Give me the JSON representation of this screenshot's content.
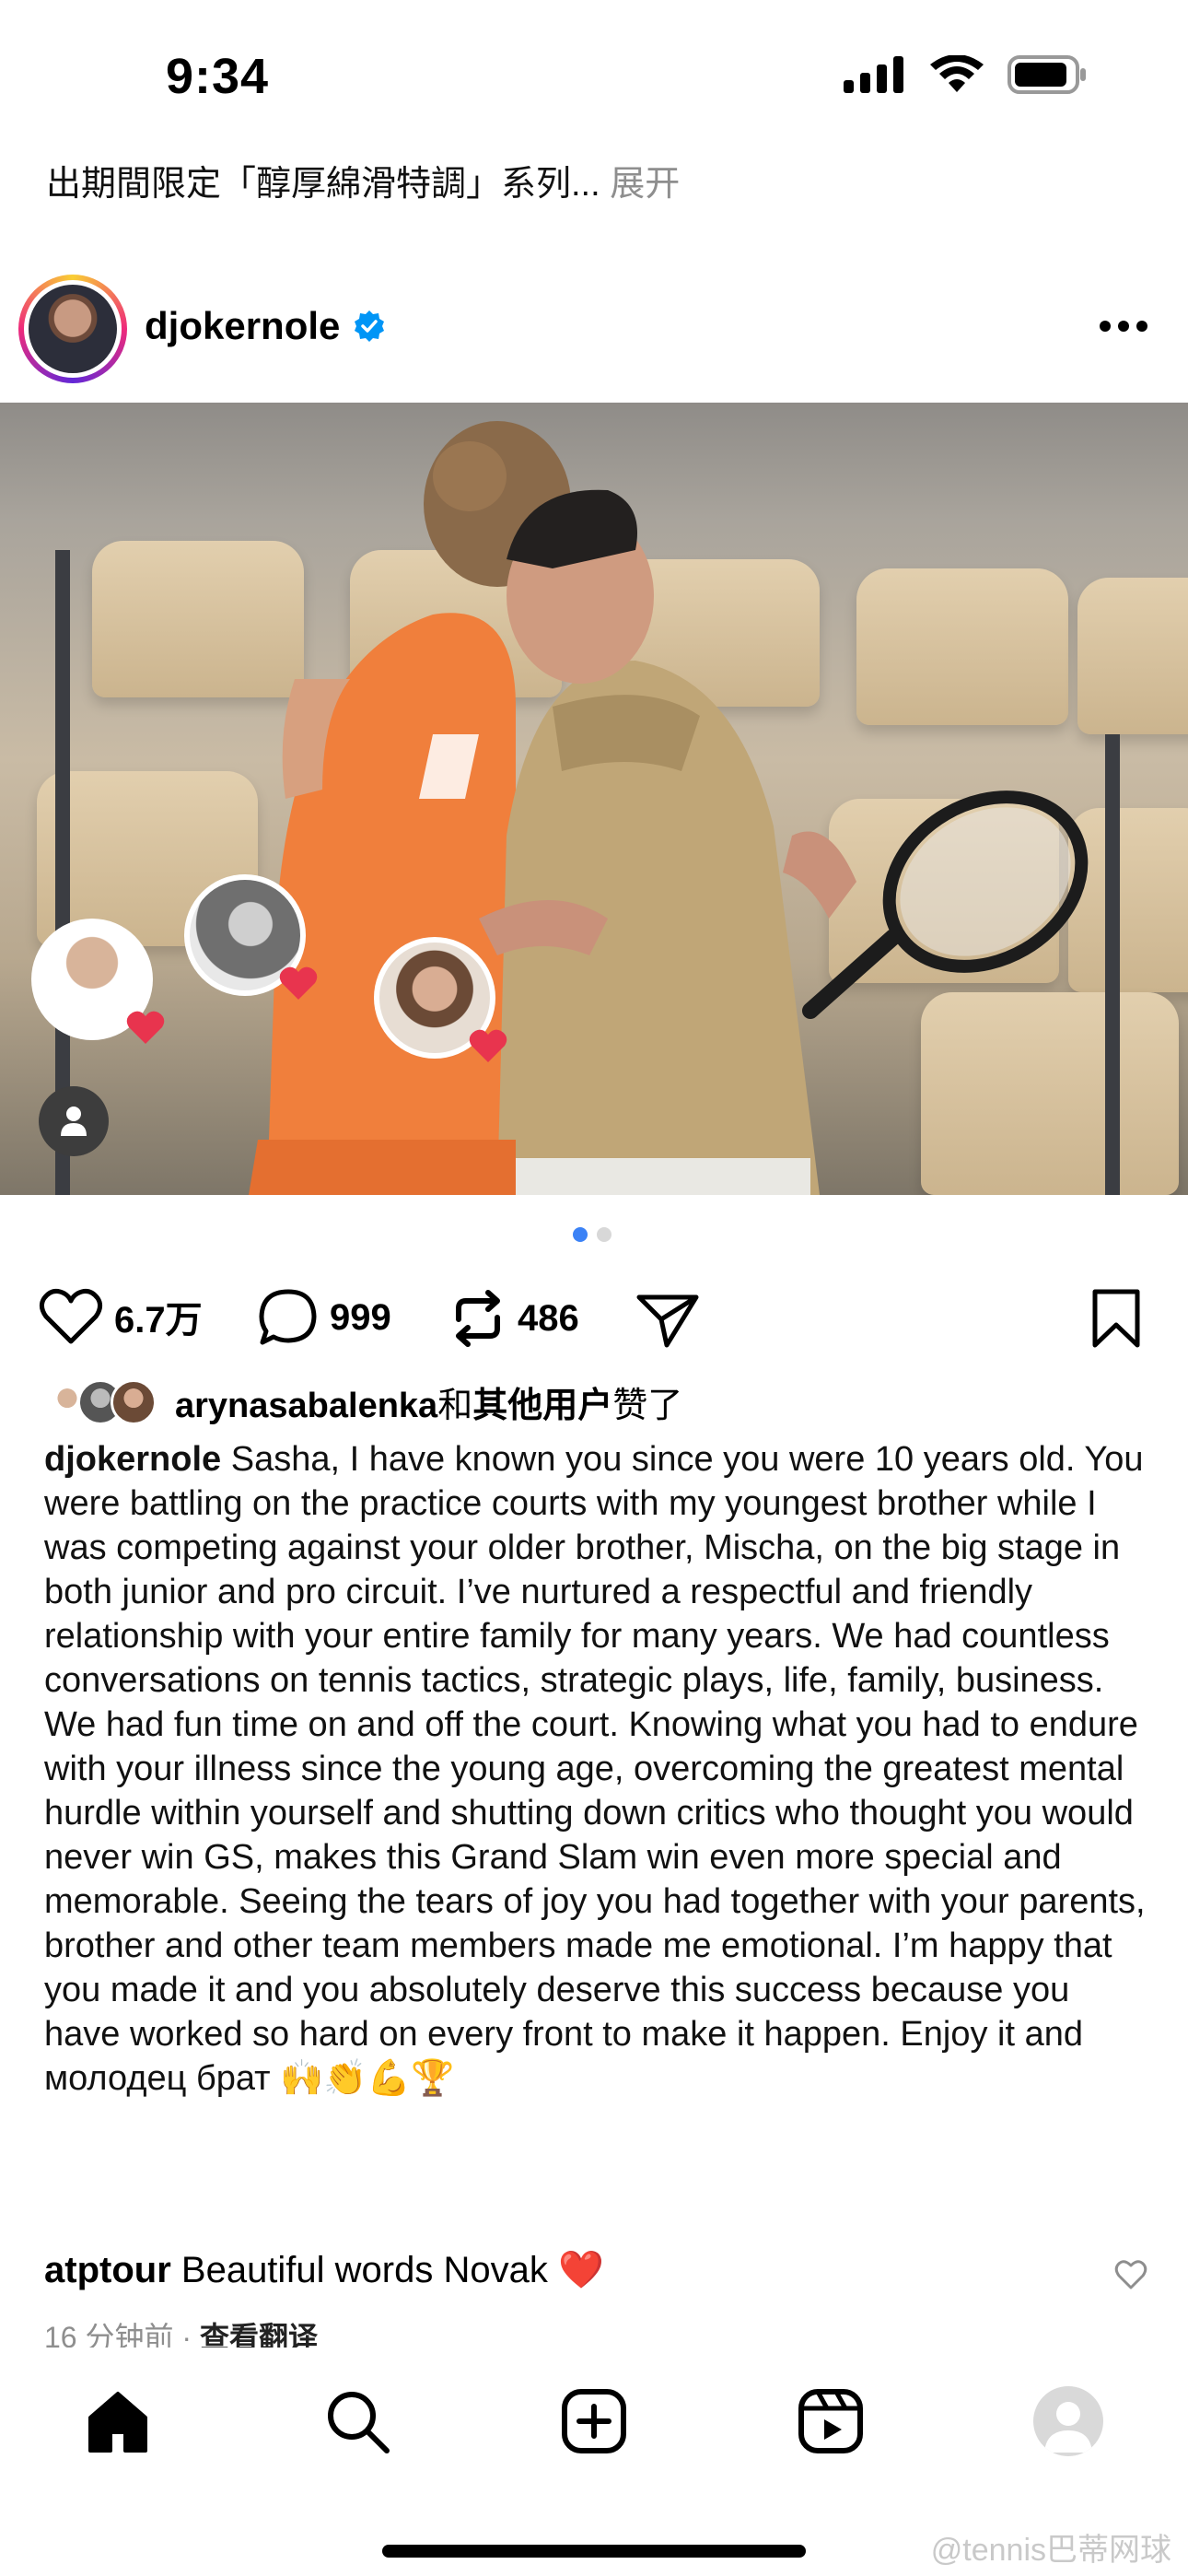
{
  "status_bar": {
    "time": "9:34"
  },
  "previous_post": {
    "caption_tail": "出期間限定「醇厚綿滑特調」系列...",
    "more_label": "展开"
  },
  "post": {
    "username": "djokernole",
    "likes_count": "6.7万",
    "comments_count": "999",
    "reposts_count": "486",
    "liked_by": {
      "user": "arynasabalenka",
      "suffix": "和",
      "others": "其他用户",
      "tail": "赞了"
    },
    "caption_user": "djokernole",
    "caption_text": "Sasha, I have known you since you were 10 years old. You were battling on the practice courts with my youngest brother while I was competing against your older brother, Mischa, on the big stage in both junior and pro circuit. I’ve nurtured a respectful and friendly relationship with your entire family for many years. We had countless conversations on tennis tactics, strategic plays, life, family, business. We had fun time on and off the court. Knowing what you had to endure with your illness since the young age, overcoming the greatest mental hurdle within yourself and shutting down critics who thought you would never win GS, makes this Grand Slam win even more special and memorable. Seeing the tears of joy you had together with your parents, brother and other team members made me emotional. I’m happy that you made it and you absolutely deserve this success because you have worked so hard on every front to make it happen. Enjoy it and молодец брат 🙌👏💪🏆",
    "comment": {
      "user": "atptour",
      "text": "Beautiful words Novak ❤️"
    },
    "timestamp": "16 分钟前",
    "translate_label": "查看翻译",
    "carousel": {
      "count": 2,
      "active": 0
    }
  },
  "nav": {
    "items": [
      "home-icon",
      "search-icon",
      "create-icon",
      "reels-icon",
      "profile-icon"
    ]
  },
  "watermark": "@tennis巴蒂网球",
  "colors": {
    "accent": "#3b82f6",
    "verified": "#0095f6",
    "heart": "#e8344e"
  }
}
